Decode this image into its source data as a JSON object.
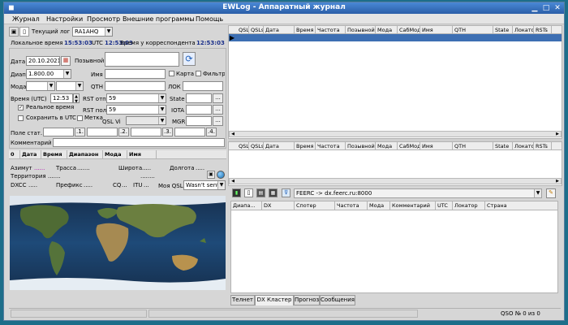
{
  "window": {
    "title": "EWLog - Аппаратный журнал"
  },
  "menu": [
    "Журнал",
    "Настройки",
    "Просмотр",
    "Внешние программы",
    "Помощь"
  ],
  "toolbar": {
    "current_log_label": "Текущий лог",
    "current_log_value": "RA1AHQ"
  },
  "clock": {
    "local_label": "Локальное время",
    "local_time": "15:53:03",
    "utc_label": "UTC",
    "utc_time": "12:53:03",
    "corr_label": "Время у корреспондента",
    "corr_time": "12:53:03"
  },
  "form": {
    "date_label": "Дата",
    "date_value": "20.10.2021",
    "callsign_label": "Позывной",
    "band_label": "Диап",
    "band_value": "1.800.00",
    "name_label": "Имя",
    "map_label": "Карта",
    "filter_label": "Фильтр",
    "mode_label": "Мода",
    "qth_label": "QTH",
    "loc_label": "ЛОК",
    "time_label": "Время (UTC)",
    "time_value": "12:53",
    "rst_sent_label": "RST отп",
    "rst_sent_value": "59",
    "state_label": "State",
    "realtime_label": "Реальное время",
    "rst_rcvd_label": "RST пол",
    "rst_rcvd_value": "59",
    "iota_label": "IOTA",
    "save_utc_label": "Сохранить в UTC",
    "mark_label": "Метка",
    "qsl_via_label": "QSL Vi",
    "mgr_label": "MGR",
    "field_stat_label": "Поле стат.",
    "field_buttons": [
      ".1.",
      ".2.",
      ".3.",
      ".4."
    ],
    "comment_label": "Комментарий",
    "dots_btn": "..."
  },
  "history_header": [
    "0",
    "Дата",
    "Время",
    "Диапазон",
    "Мода",
    "Имя"
  ],
  "info": {
    "azimuth_label": "Азимут",
    "azimuth_value": "......",
    "route_label": "Трасса",
    "route_value": ".......",
    "lat_label": "Широта",
    "lat_value": ".....",
    "lon_label": "Долгота",
    "lon_value": ".....",
    "territory_label": "Территория",
    "territory_value": ".......",
    "extra_value": "........",
    "dxcc_label": "DXCC",
    "dxcc_value": ".....",
    "prefix_label": "Префикс",
    "prefix_value": ".....",
    "cq_label": "CQ",
    "cq_value": "...",
    "itu_label": "ITU",
    "itu_value": "...",
    "my_qsl_label": "Моя QSL",
    "my_qsl_value": "Wasn't sent"
  },
  "log_columns": [
    "QSL",
    "QSLs",
    "Дата",
    "Время",
    "Частота",
    "Позывной",
    "Мода",
    "СабМод",
    "Имя",
    "QTH",
    "State",
    "Локатор",
    "RSTs"
  ],
  "cluster": {
    "server": "FEERC -> dx.feerc.ru:8000",
    "columns": [
      "Диапа...",
      "DX",
      "Спотер",
      "Частота",
      "Мода",
      "Комментарий",
      "UTC",
      "Локатор",
      "Страна"
    ]
  },
  "bottom_tabs": [
    "Телнет",
    "DX Кластер",
    "Прогноз",
    "Сообщения"
  ],
  "status": {
    "qso": "QSO № 0 из 0"
  },
  "colors": {
    "title_bg": "#2f6cb8",
    "time_blue": "#1a2f8a",
    "selection": "#3d6fb3",
    "desktop": "#1d6e8a"
  },
  "icons": {
    "new_log": "save-icon",
    "refresh": "refresh-icon",
    "globe": "globe-icon",
    "filter": "filter-icon"
  }
}
